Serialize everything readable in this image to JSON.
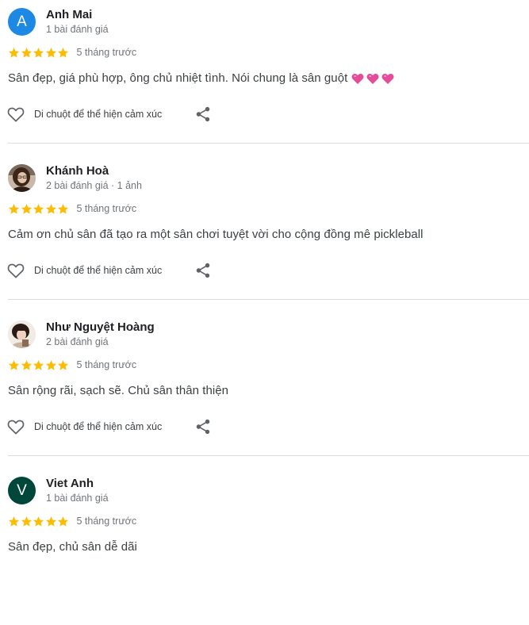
{
  "reviews": [
    {
      "name": "Anh Mai",
      "meta": "1 bài đánh giá",
      "avatar_letter": "A",
      "avatar_color": "#1e88e5",
      "avatar_type": "letter",
      "rating": 5,
      "time": "5 tháng trước",
      "text": "Sân đẹp, giá phù hợp, ông chủ nhiệt tình. Nói chung là sân guột",
      "emoji": "pink-heart-icon x3",
      "like_label": "Di chuột để thể hiện cảm xúc"
    },
    {
      "name": "Khánh Hoà",
      "meta": "2 bài đánh giá · 1 ảnh",
      "avatar_letter": "",
      "avatar_color": "#6b4a3a",
      "avatar_type": "photo",
      "rating": 5,
      "time": "5 tháng trước",
      "text": "Cảm ơn chủ sân đã tạo ra một sân chơi tuyệt vời cho cộng đồng mê pickleball",
      "like_label": "Di chuột để thể hiện cảm xúc"
    },
    {
      "name": "Như Nguyệt Hoàng",
      "meta": "2 bài đánh giá",
      "avatar_letter": "",
      "avatar_color": "#3a2a24",
      "avatar_type": "photo",
      "rating": 5,
      "time": "5 tháng trước",
      "text": "Sân rộng rãi, sạch sẽ. Chủ sân thân thiện",
      "like_label": "Di chuột để thể hiện cảm xúc"
    },
    {
      "name": "Viet Anh",
      "meta": "1 bài đánh giá",
      "avatar_letter": "V",
      "avatar_color": "#00473a",
      "avatar_type": "letter",
      "rating": 5,
      "time": "5 tháng trước",
      "text": "Sân đẹp, chủ sân dễ dãi",
      "like_label": "Di chuột để thể hiện cảm xúc"
    }
  ],
  "colors": {
    "star": "#fbbc04",
    "text_secondary": "#70757a",
    "divider": "#dadce0",
    "heart_emoji": "#e44c9a"
  }
}
